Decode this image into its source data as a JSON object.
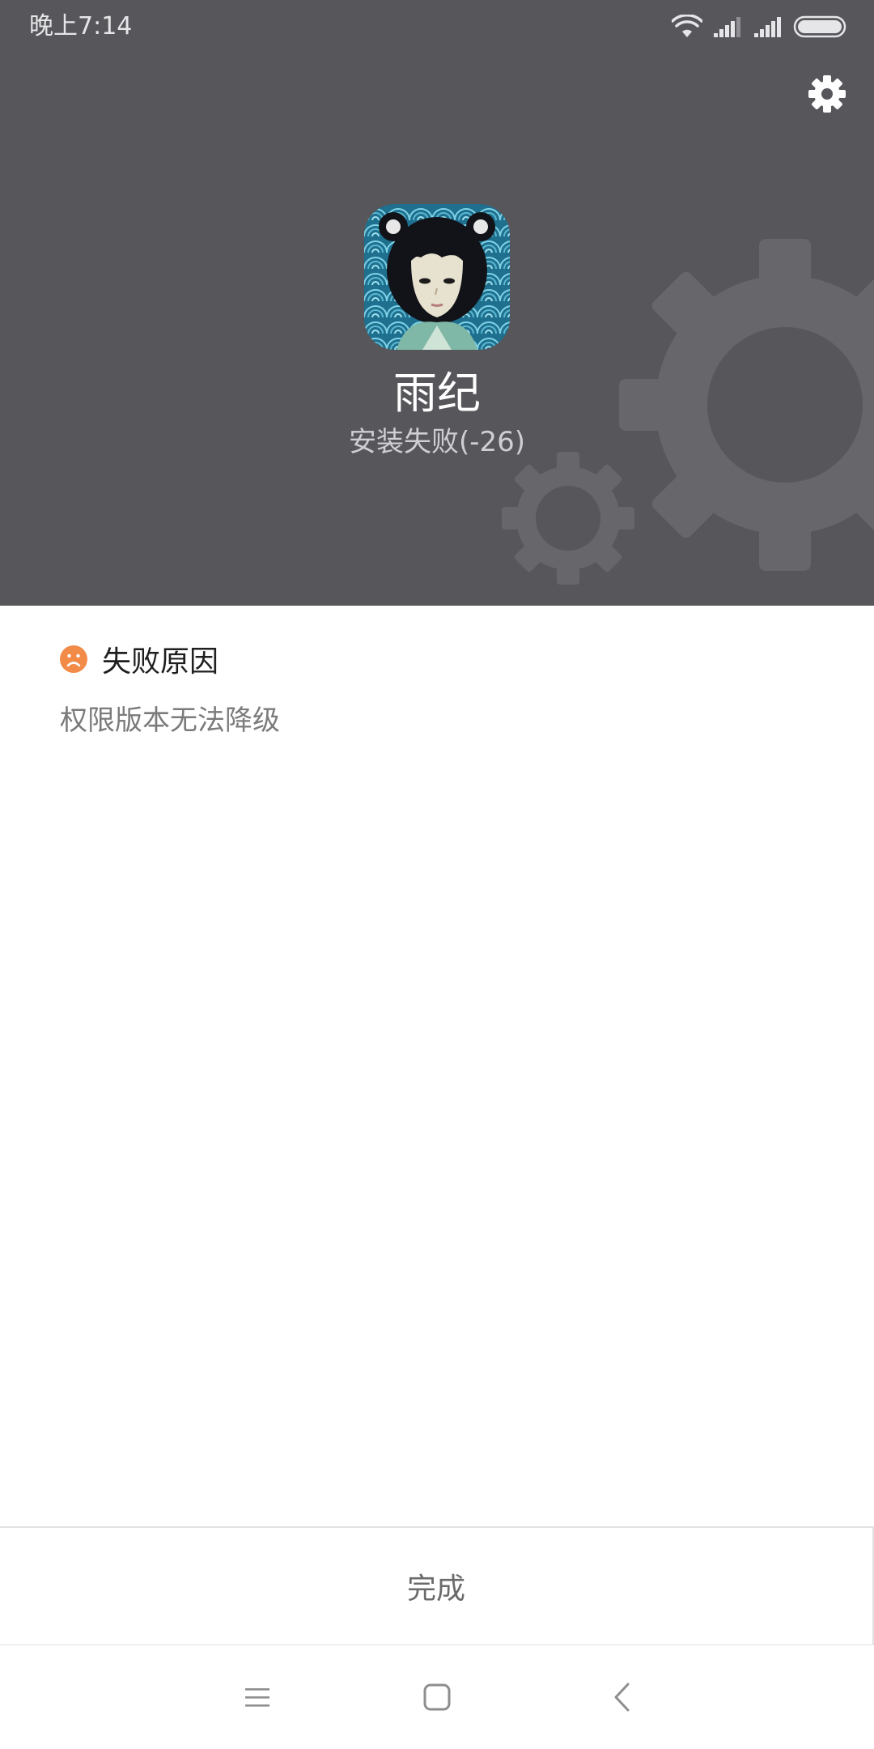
{
  "status_bar": {
    "time": "晚上7:14",
    "icons": [
      "wifi-icon",
      "signal-icon",
      "signal-icon",
      "battery-icon"
    ]
  },
  "header": {
    "settings_icon": "gear-icon",
    "app_name": "雨纪",
    "install_status": "安装失败(-26)",
    "background_color": "#57565b"
  },
  "failure": {
    "icon": "sad-face-icon",
    "icon_color": "#f28a48",
    "title": "失败原因",
    "detail": "权限版本无法降级"
  },
  "footer": {
    "done_label": "完成"
  },
  "nav_bar": {
    "buttons": [
      "menu-icon",
      "home-icon",
      "back-icon"
    ]
  }
}
